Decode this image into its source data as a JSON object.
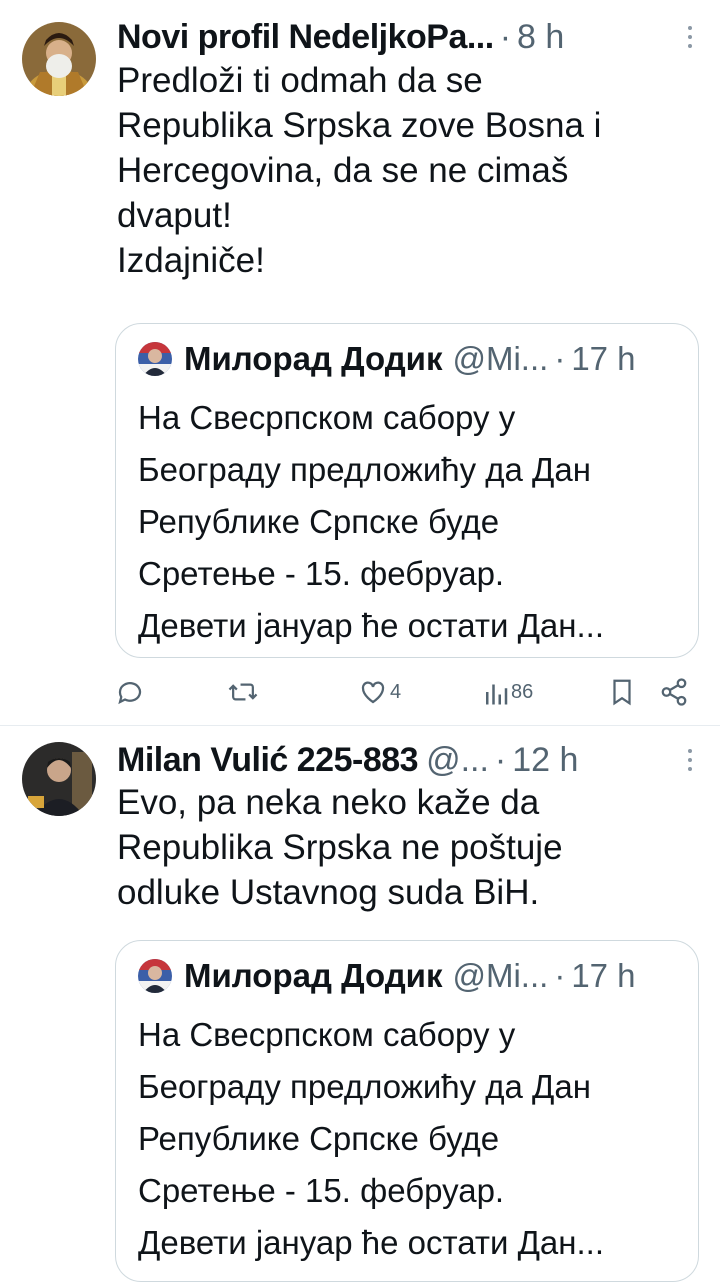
{
  "tweets": [
    {
      "author": "Novi profil NedeljkoPa...",
      "handle": "",
      "dot": "·",
      "time": "8 h",
      "text_lines": [
        "Predloži ti odmah da se",
        "Republika Srpska zove Bosna i",
        "Hercegovina, da se ne cimaš",
        "dvaput!",
        "Izdajniče!"
      ],
      "quote": {
        "author": "Милорад Додик",
        "handle": "@Mi...",
        "dot": "·",
        "time": "17 h",
        "text_lines": [
          "На Свесрпском сабору у",
          "Београду предложићу да Дан",
          "Републике Српске буде",
          "Сретење - 15. фебруар.",
          "Девети јануар ће остати Дан..."
        ]
      },
      "actions": {
        "reply_count": "",
        "retweet_count": "",
        "like_count": "4",
        "view_count": "86"
      }
    },
    {
      "author": "Milan Vulić 225-883",
      "handle": "@...",
      "dot": "·",
      "time": "12 h",
      "text_lines": [
        "Evo, pa neka neko kaže da",
        "Republika Srpska ne poštuje",
        "odluke Ustavnog suda BiH."
      ],
      "quote": {
        "author": "Милорад Додик",
        "handle": "@Mi...",
        "dot": "·",
        "time": "17 h",
        "text_lines": [
          "На Свесрпском сабору у",
          "Београду предложићу да Дан",
          "Републике Српске буде",
          "Сретење - 15. фебруар.",
          "Девети јануар ће остати Дан..."
        ]
      }
    }
  ],
  "colors": {
    "text": "#0f1419",
    "secondary": "#536471",
    "border": "#cfd9de"
  }
}
